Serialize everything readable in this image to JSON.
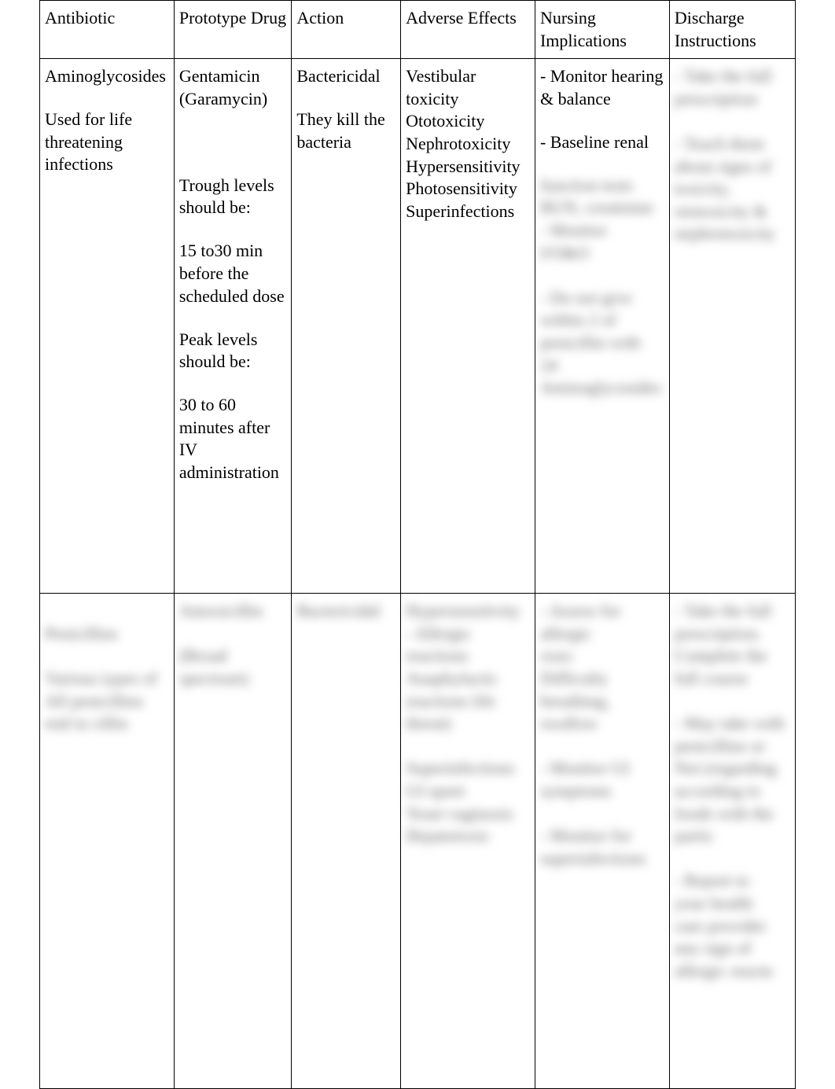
{
  "headers": {
    "antibiotic": "Antibiotic",
    "prototype": "Prototype Drug",
    "action": "Action",
    "adverse": "Adverse Effects",
    "nursing": "Nursing Implications",
    "discharge": "Discharge Instructions"
  },
  "row1": {
    "antibiotic_name": "Aminoglycosides",
    "antibiotic_use": "Used for life threatening infections",
    "proto_name": "Gentamicin (Garamycin)",
    "proto_trough_label": "Trough levels should be:",
    "proto_trough_val": "15 to30 min before the scheduled dose",
    "proto_peak_label": "Peak levels should be:",
    "proto_peak_val": "30 to 60 minutes after IV administration",
    "action_1": "Bactericidal",
    "action_2": "They kill the bacteria",
    "adverse_1": "Vestibular toxicity",
    "adverse_2": "Ototoxicity",
    "adverse_3": "Nephrotoxicity",
    "adverse_4": "Hypersensitivity",
    "adverse_5": "Photosensitivity",
    "adverse_6": "Superinfections",
    "nursing_1": "- Monitor hearing & balance",
    "nursing_2": "- Baseline renal",
    "nursing_blur": "function tests\nBUN,  creatinine\n- Monitor\nI/O&O\n\n- Do not give\nwithin 2 of\npenicillin with\n24\nAminoglycosides",
    "discharge_blur": "- Take the full\nprescription\n\n- Teach them\nabout signs of\ntoxicity,\nototoxicity &\nnephrotoxicity"
  },
  "row2": {
    "antibiotic_blur": "Penicillins\n\nVarious types of\nAll penicillins\nend in   cillin",
    "proto_blur": "Amoxicillin\n\n(Broad\nspectrum)",
    "action_blur": "Bactericidal",
    "adverse_blur": "Hypersensitivity\n- Allergic\nreactions\nAnaphylactic\nreactions   life\nthreat)\n\nSuperinfections\nGI upset\nYeast vaginosis\nHepatotoxic",
    "nursing_blur": "- Assess for\nallergic\nrxns:\nDifficulty\nbreathing,\nswallow\n\n- Monitor GI\nsymptoms\n\n- Monitor for\nsuperinfections",
    "discharge_blur": "- Take the full\nprescription.\nComplete the\nfull course\n\n- May take with\npenicillins or\nNot (regarding\naccording to\nfoods with the\npartic\n\n- Report to\nyour health\ncare provider\nany sign of\nallergic reactn"
  }
}
